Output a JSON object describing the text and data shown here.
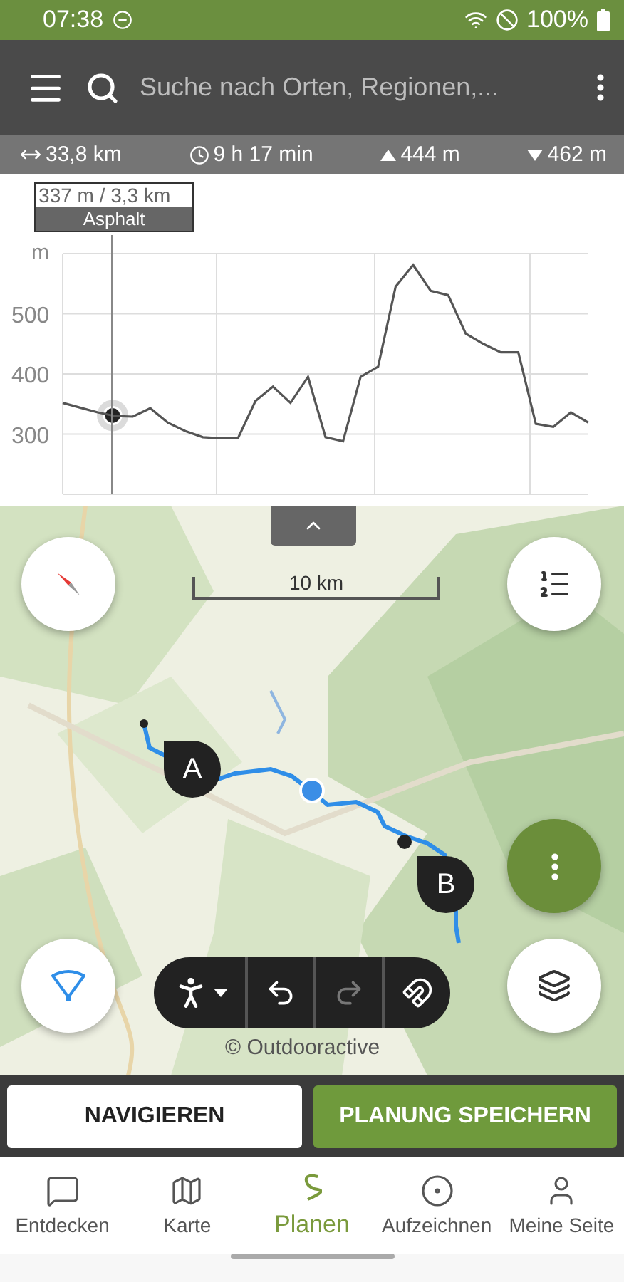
{
  "status_bar": {
    "time": "07:38",
    "battery": "100%"
  },
  "app_bar": {
    "search_placeholder": "Suche nach Orten, Regionen,..."
  },
  "stats": [
    {
      "kind": "distance",
      "text": "33,8 km"
    },
    {
      "kind": "duration",
      "text": "9 h 17 min"
    },
    {
      "kind": "ascent",
      "text": "444 m"
    },
    {
      "kind": "descent",
      "text": "462 m"
    }
  ],
  "elevation_profile": {
    "tooltip": {
      "value": "337 m / 3,3 km",
      "surface": "Asphalt",
      "level": 0.095
    },
    "chart_data": {
      "type": "line",
      "grid": true,
      "ylabel": "m",
      "ylim": [
        200,
        600
      ],
      "yticks": [
        300,
        400,
        500
      ],
      "series": [
        {
          "color": "#555555",
          "values": [
            352,
            344,
            336,
            330,
            329,
            343,
            319,
            305,
            295,
            293,
            293,
            355,
            379,
            352,
            395,
            295,
            288,
            395,
            412,
            545,
            581,
            538,
            531,
            467,
            450,
            436,
            436,
            317,
            312,
            336,
            319
          ]
        }
      ]
    }
  },
  "map": {
    "scale": "10 km",
    "attribution": "© Outdooractive",
    "markers": [
      {
        "label": "A"
      },
      {
        "label": "B"
      }
    ],
    "toolbar": [
      {
        "kind": "profile",
        "disabled": false
      },
      {
        "kind": "undo",
        "disabled": false
      },
      {
        "kind": "redo",
        "disabled": true
      },
      {
        "kind": "snap",
        "disabled": false
      }
    ]
  },
  "actions": [
    {
      "kind": "secondary",
      "label": "NAVIGIEREN"
    },
    {
      "kind": "primary",
      "label": "PLANUNG SPEICHERN"
    }
  ],
  "nav": [
    {
      "kind": "discover",
      "label": "Entdecken",
      "selected": false
    },
    {
      "kind": "map",
      "label": "Karte",
      "selected": false
    },
    {
      "kind": "plan",
      "label": "Planen",
      "selected": true
    },
    {
      "kind": "record",
      "label": "Aufzeichnen",
      "selected": false
    },
    {
      "kind": "profile",
      "label": "Meine Seite",
      "selected": false
    }
  ]
}
